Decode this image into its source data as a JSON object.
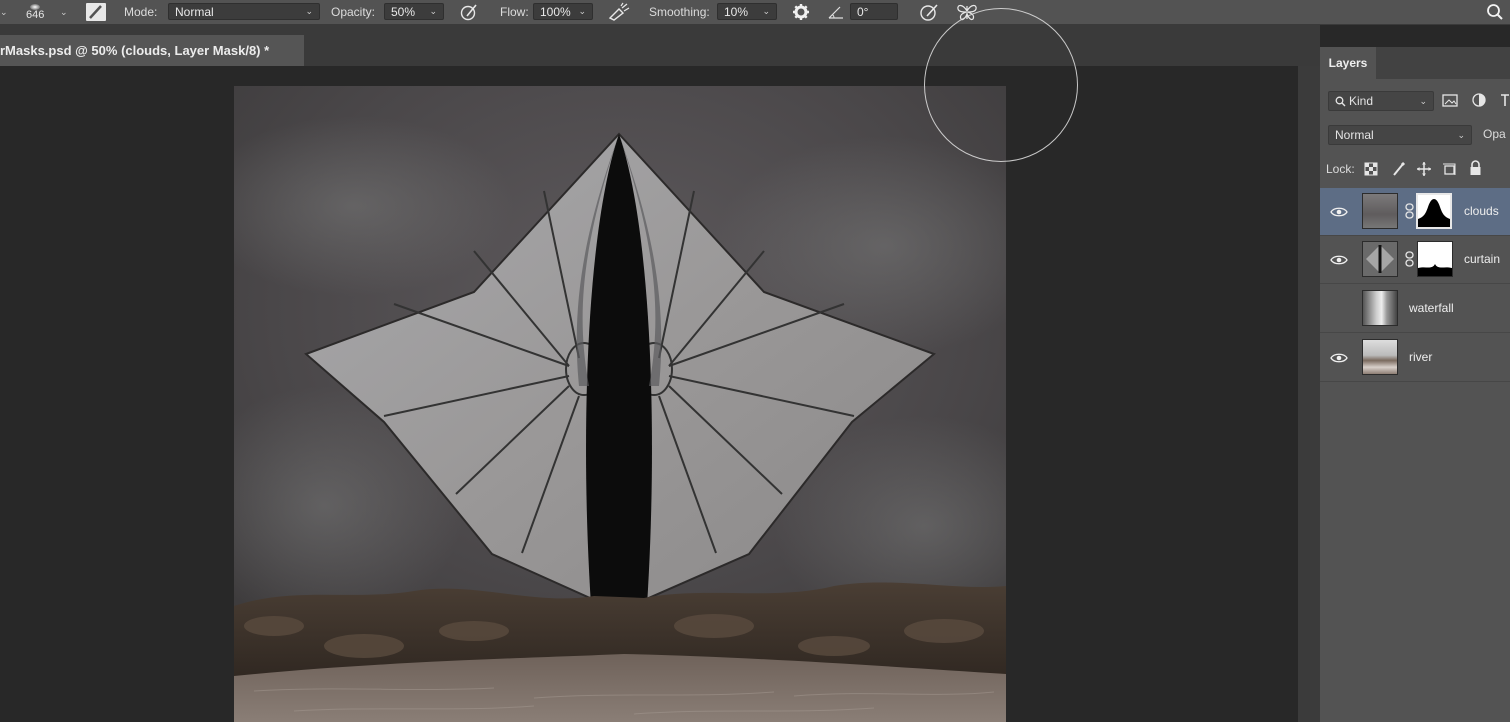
{
  "options_bar": {
    "brush_size": "646",
    "mode_label": "Mode:",
    "mode_value": "Normal",
    "opacity_label": "Opacity:",
    "opacity_value": "50%",
    "flow_label": "Flow:",
    "flow_value": "100%",
    "smoothing_label": "Smoothing:",
    "smoothing_value": "10%",
    "angle_value": "0°",
    "icons": [
      "brush-preset-icon",
      "brush-panel-icon",
      "pressure-opacity-icon",
      "airbrush-icon",
      "smoothing-settings-gear-icon",
      "angle-icon",
      "pressure-size-icon",
      "symmetry-butterfly-icon",
      "search-icon"
    ]
  },
  "document": {
    "tab_title": "rMasks.psd @ 50% (clouds, Layer Mask/8) *"
  },
  "layers_panel": {
    "tab_label": "Layers",
    "filter_kind": "Kind",
    "blend_mode": "Normal",
    "opacity_label_partial": "Opa",
    "lock_label": "Lock:",
    "layers": [
      {
        "name": "clouds",
        "visible": true,
        "selected": true,
        "has_mask": true
      },
      {
        "name": "curtain",
        "visible": true,
        "selected": false,
        "has_mask": true
      },
      {
        "name": "waterfall",
        "visible": false,
        "selected": false,
        "has_mask": false
      },
      {
        "name": "river",
        "visible": true,
        "selected": false,
        "has_mask": false
      }
    ]
  },
  "colors": {
    "options_bar_bg": "#535353",
    "workspace_bg": "#282828",
    "selected_layer_bg": "#5d6d85"
  }
}
